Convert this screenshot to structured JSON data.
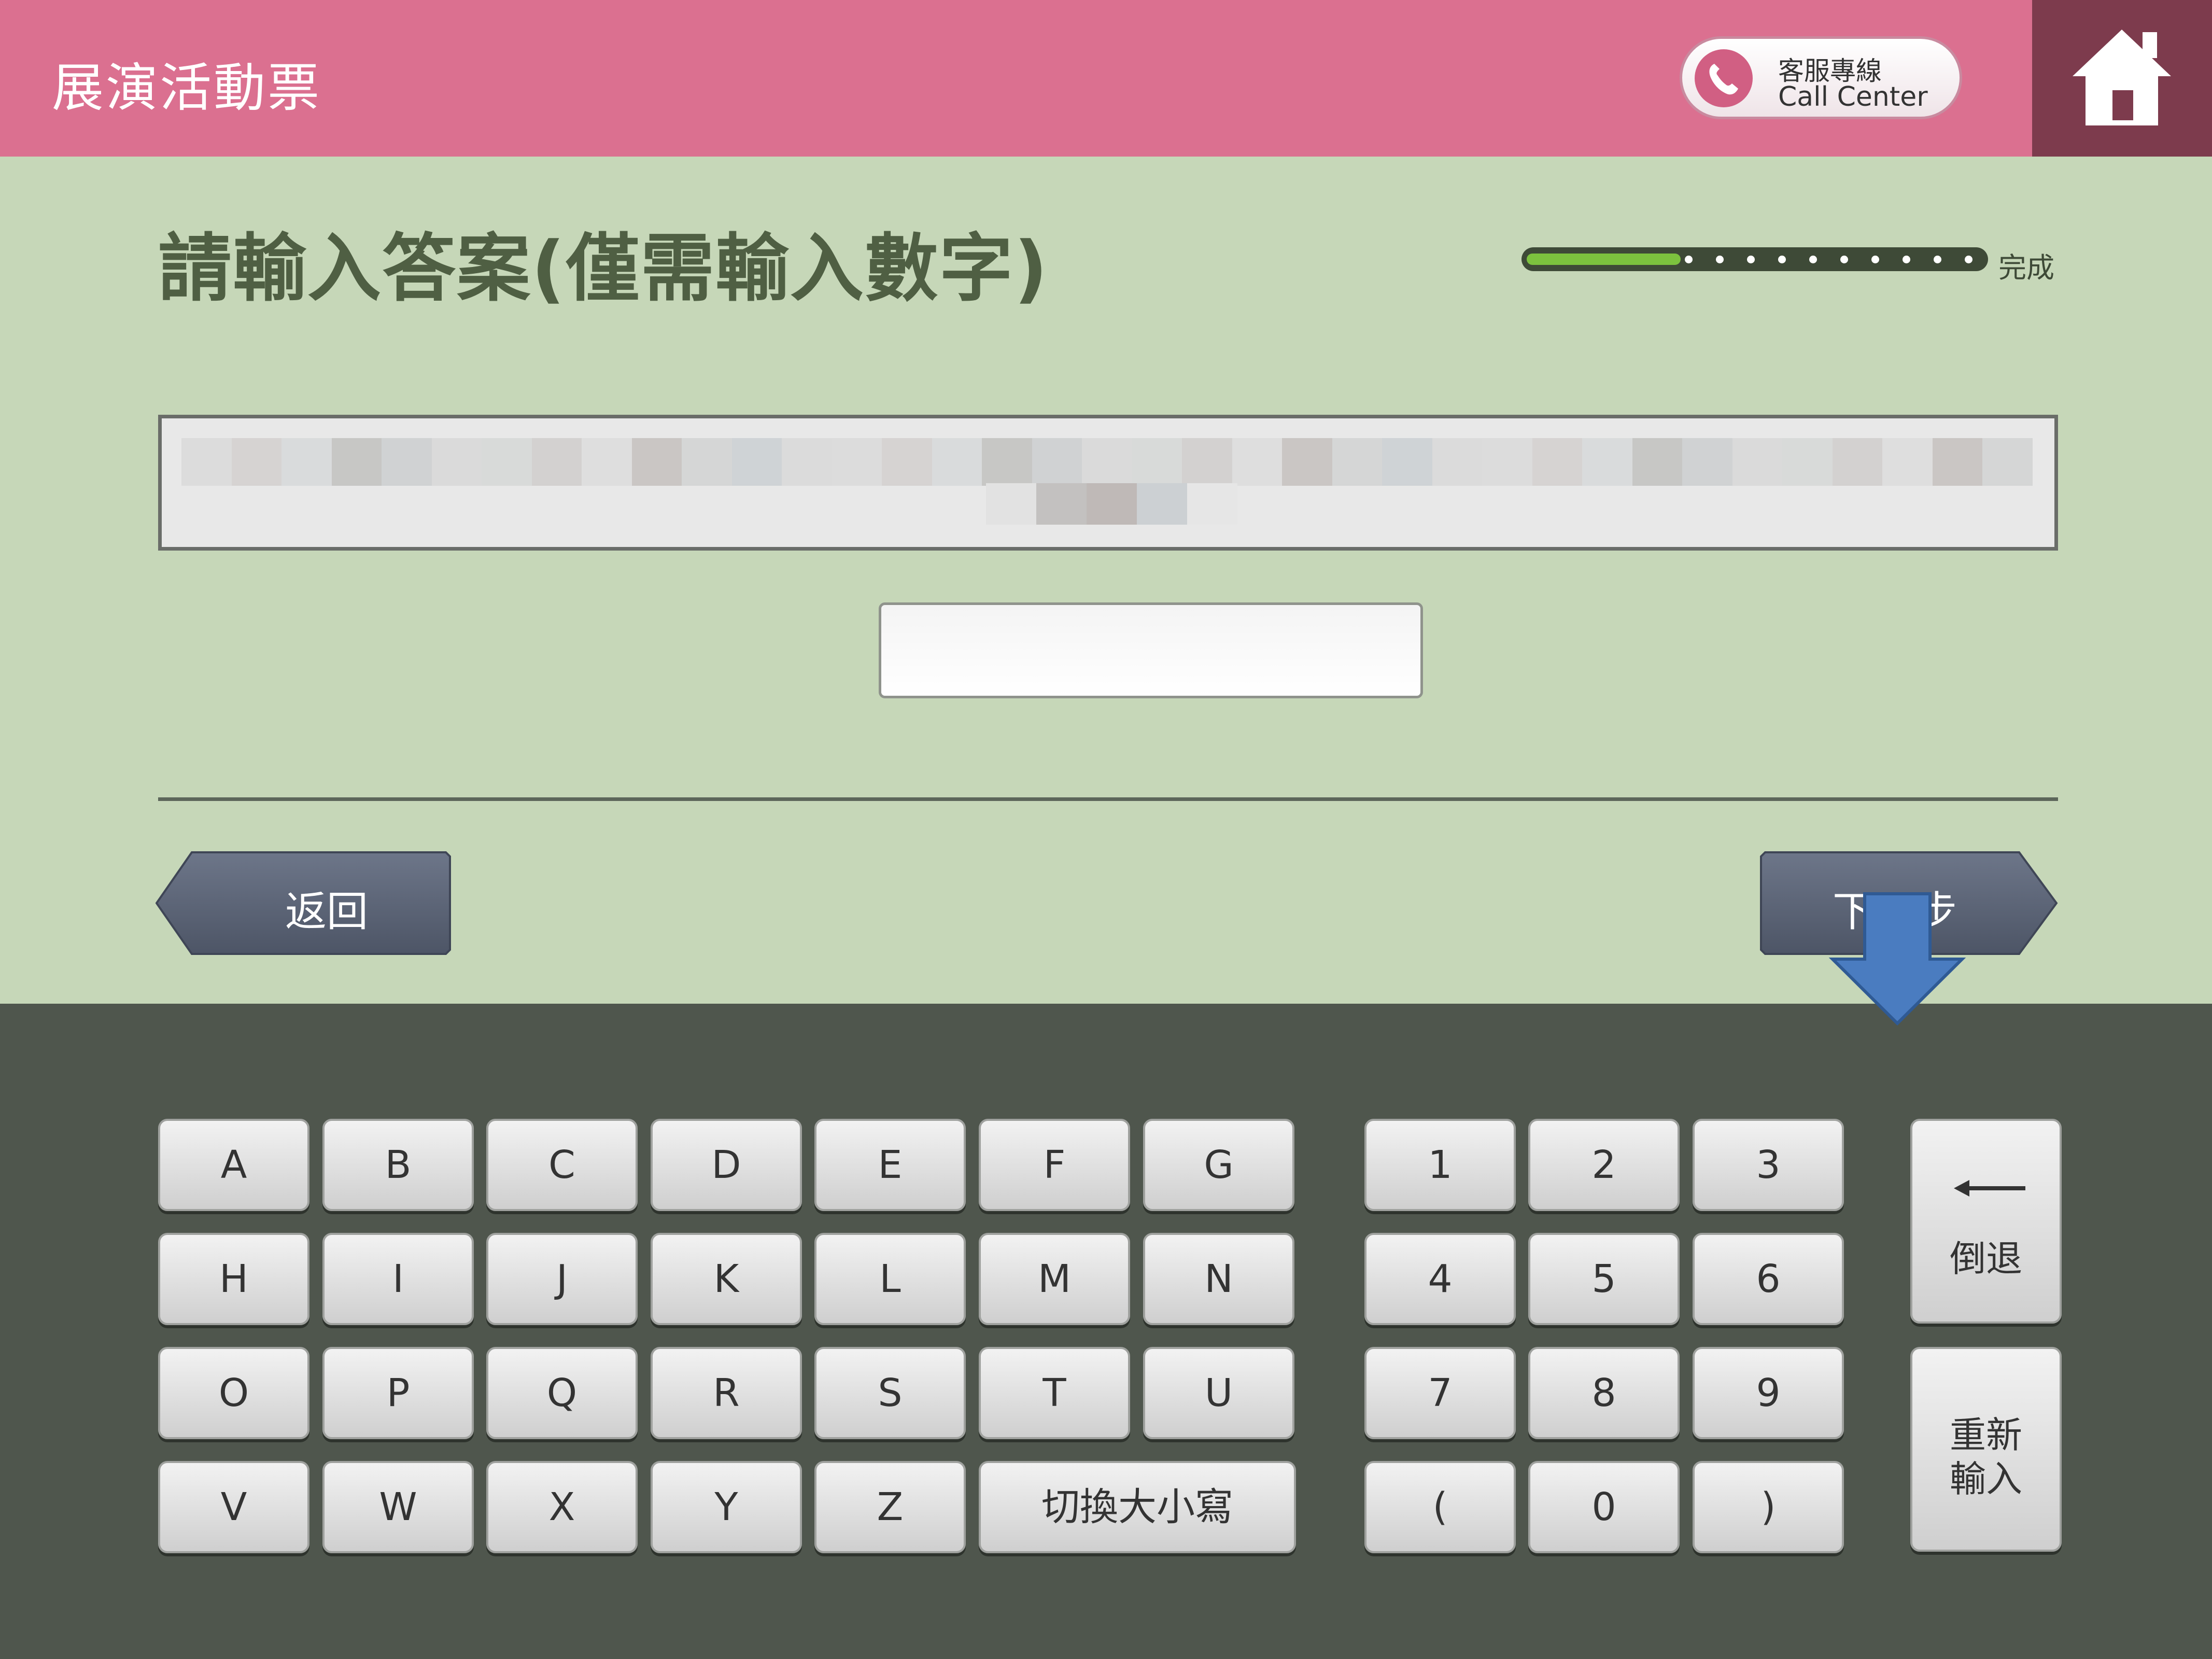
{
  "header": {
    "title": "展演活動票",
    "call_center_zh": "客服專線",
    "call_center_en": "Call Center"
  },
  "main": {
    "prompt": "請輸入答案(僅需輸入數字)",
    "progress_label": "完成",
    "progress_fraction": 0.33,
    "answer_value": "",
    "back_label": "返回",
    "next_label": "下一步"
  },
  "keyboard": {
    "letters": [
      "A",
      "B",
      "C",
      "D",
      "E",
      "F",
      "G",
      "H",
      "I",
      "J",
      "K",
      "L",
      "M",
      "N",
      "O",
      "P",
      "Q",
      "R",
      "S",
      "T",
      "U",
      "V",
      "W",
      "X",
      "Y",
      "Z"
    ],
    "case_toggle": "切換大小寫",
    "digits": [
      "1",
      "2",
      "3",
      "4",
      "5",
      "6",
      "7",
      "8",
      "9",
      "(",
      "0",
      ")"
    ],
    "backspace_label": "倒退",
    "reset_label_line1": "重新",
    "reset_label_line2": "輸入"
  },
  "colors": {
    "header_bg": "#db7090",
    "home_bg": "#7d3b4d",
    "main_bg": "#c6d7b8",
    "keyboard_bg": "#4f564d",
    "prompt_text": "#4f5f43",
    "nav_button": "#5c6576",
    "pointer_arrow": "#4a7cc0",
    "progress_fill": "#7cc23e"
  },
  "icons": [
    "phone-icon",
    "home-icon",
    "back-arrow-icon",
    "backspace-arrow-icon"
  ]
}
